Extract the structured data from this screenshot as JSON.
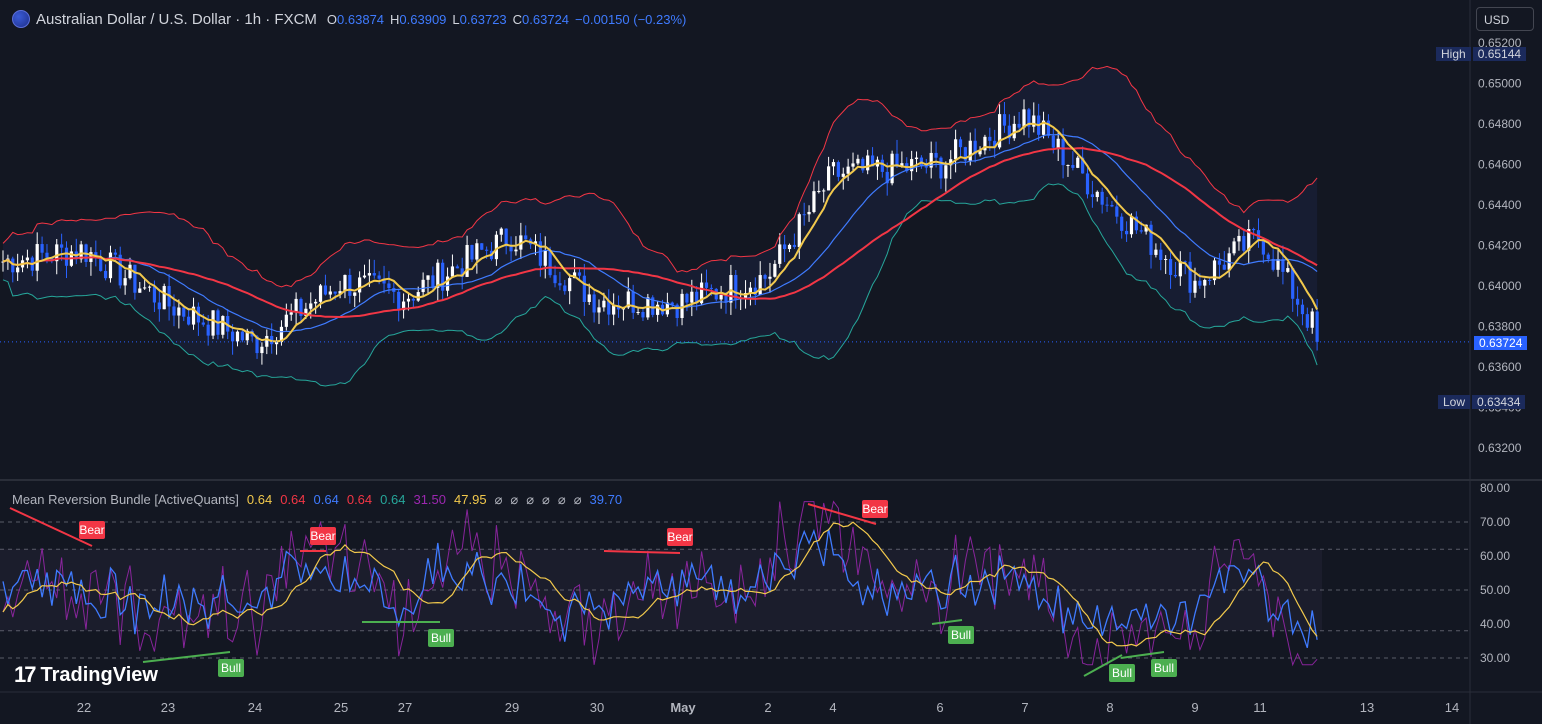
{
  "header": {
    "symbol": "Australian Dollar / U.S. Dollar · 1h · FXCM",
    "open_label": "O",
    "open": "0.63874",
    "high_label": "H",
    "high": "0.63909",
    "low_label": "L",
    "low": "0.63723",
    "close_label": "C",
    "close": "0.63724",
    "change": "−0.00150 (−0.23%)"
  },
  "currency_button": "USD",
  "price_axis": {
    "ticks": [
      "0.65200",
      "0.65000",
      "0.64800",
      "0.64600",
      "0.64400",
      "0.64200",
      "0.64000",
      "0.63800",
      "0.63600",
      "0.63400",
      "0.63200"
    ],
    "high_tag": "High",
    "high_value": "0.65144",
    "low_tag": "Low",
    "low_value": "0.63434",
    "current": "0.63724"
  },
  "indicator": {
    "name": "Mean Reversion Bundle [ActiveQuants]",
    "values": [
      {
        "text": "0.64",
        "color": "#f2c94c"
      },
      {
        "text": "0.64",
        "color": "#f23645"
      },
      {
        "text": "0.64",
        "color": "#3f7bff"
      },
      {
        "text": "0.64",
        "color": "#f23645"
      },
      {
        "text": "0.64",
        "color": "#26a69a"
      },
      {
        "text": "31.50",
        "color": "#9c27b0"
      },
      {
        "text": "47.95",
        "color": "#f2c94c"
      },
      {
        "text": "⌀",
        "color": "#b2b5be"
      },
      {
        "text": "⌀",
        "color": "#b2b5be"
      },
      {
        "text": "⌀",
        "color": "#b2b5be"
      },
      {
        "text": "⌀",
        "color": "#b2b5be"
      },
      {
        "text": "⌀",
        "color": "#b2b5be"
      },
      {
        "text": "⌀",
        "color": "#b2b5be"
      },
      {
        "text": "39.70",
        "color": "#3f7bff"
      }
    ],
    "axis_ticks": [
      "80.00",
      "70.00",
      "60.00",
      "50.00",
      "40.00",
      "30.00"
    ],
    "signals": [
      {
        "label": "Bear",
        "type": "bear"
      },
      {
        "label": "Bear",
        "type": "bear"
      },
      {
        "label": "Bear",
        "type": "bear"
      },
      {
        "label": "Bear",
        "type": "bear"
      },
      {
        "label": "Bull",
        "type": "bull"
      },
      {
        "label": "Bull",
        "type": "bull"
      },
      {
        "label": "Bull",
        "type": "bull"
      },
      {
        "label": "Bull",
        "type": "bull"
      },
      {
        "label": "Bull",
        "type": "bull"
      }
    ]
  },
  "time_axis": [
    "22",
    "23",
    "24",
    "25",
    "27",
    "29",
    "30",
    "May",
    "2",
    "4",
    "6",
    "7",
    "8",
    "9",
    "11",
    "13",
    "14"
  ],
  "logo": "TradingView",
  "colors": {
    "background": "#131722",
    "bull_candle": "#ffffff",
    "bear_candle": "#2962ff",
    "upper_band": "#f23645",
    "lower_band": "#26a69a",
    "fast_ma": "#f2c94c",
    "slow_ma": "#f23645",
    "basis": "#3f7bff",
    "rsi": "#9c27b0"
  },
  "chart_data": {
    "type": "candlestick",
    "x_range": [
      "Apr 21",
      "May 14"
    ],
    "ylim": [
      0.6315,
      0.6525
    ],
    "close_path": [
      {
        "t": "Apr 21",
        "c": 0.6412
      },
      {
        "t": "Apr 22",
        "c": 0.6418
      },
      {
        "t": "Apr 23",
        "c": 0.6391
      },
      {
        "t": "Apr 24",
        "c": 0.6372
      },
      {
        "t": "Apr 25",
        "c": 0.6402
      },
      {
        "t": "Apr 27",
        "c": 0.6395
      },
      {
        "t": "Apr 29",
        "c": 0.6425
      },
      {
        "t": "Apr 30",
        "c": 0.6393
      },
      {
        "t": "May 1",
        "c": 0.6392
      },
      {
        "t": "May 2",
        "c": 0.6405
      },
      {
        "t": "May 4",
        "c": 0.6455
      },
      {
        "t": "May 6",
        "c": 0.646
      },
      {
        "t": "May 7",
        "c": 0.6485
      },
      {
        "t": "May 8",
        "c": 0.644
      },
      {
        "t": "May 9",
        "c": 0.6402
      },
      {
        "t": "May 11",
        "c": 0.6425
      },
      {
        "t": "May 12",
        "c": 0.63724
      }
    ],
    "extremes": {
      "high": 0.65144,
      "low": 0.63434,
      "last": 0.63724
    },
    "oscillator": {
      "ylim": [
        25,
        82
      ],
      "overbought": 70,
      "oversold": 30,
      "upper_mid": 62,
      "lower_mid": 38,
      "mid": 50,
      "last_rsi": 31.5,
      "last_signal": 47.95,
      "last_blue": 39.7
    }
  }
}
